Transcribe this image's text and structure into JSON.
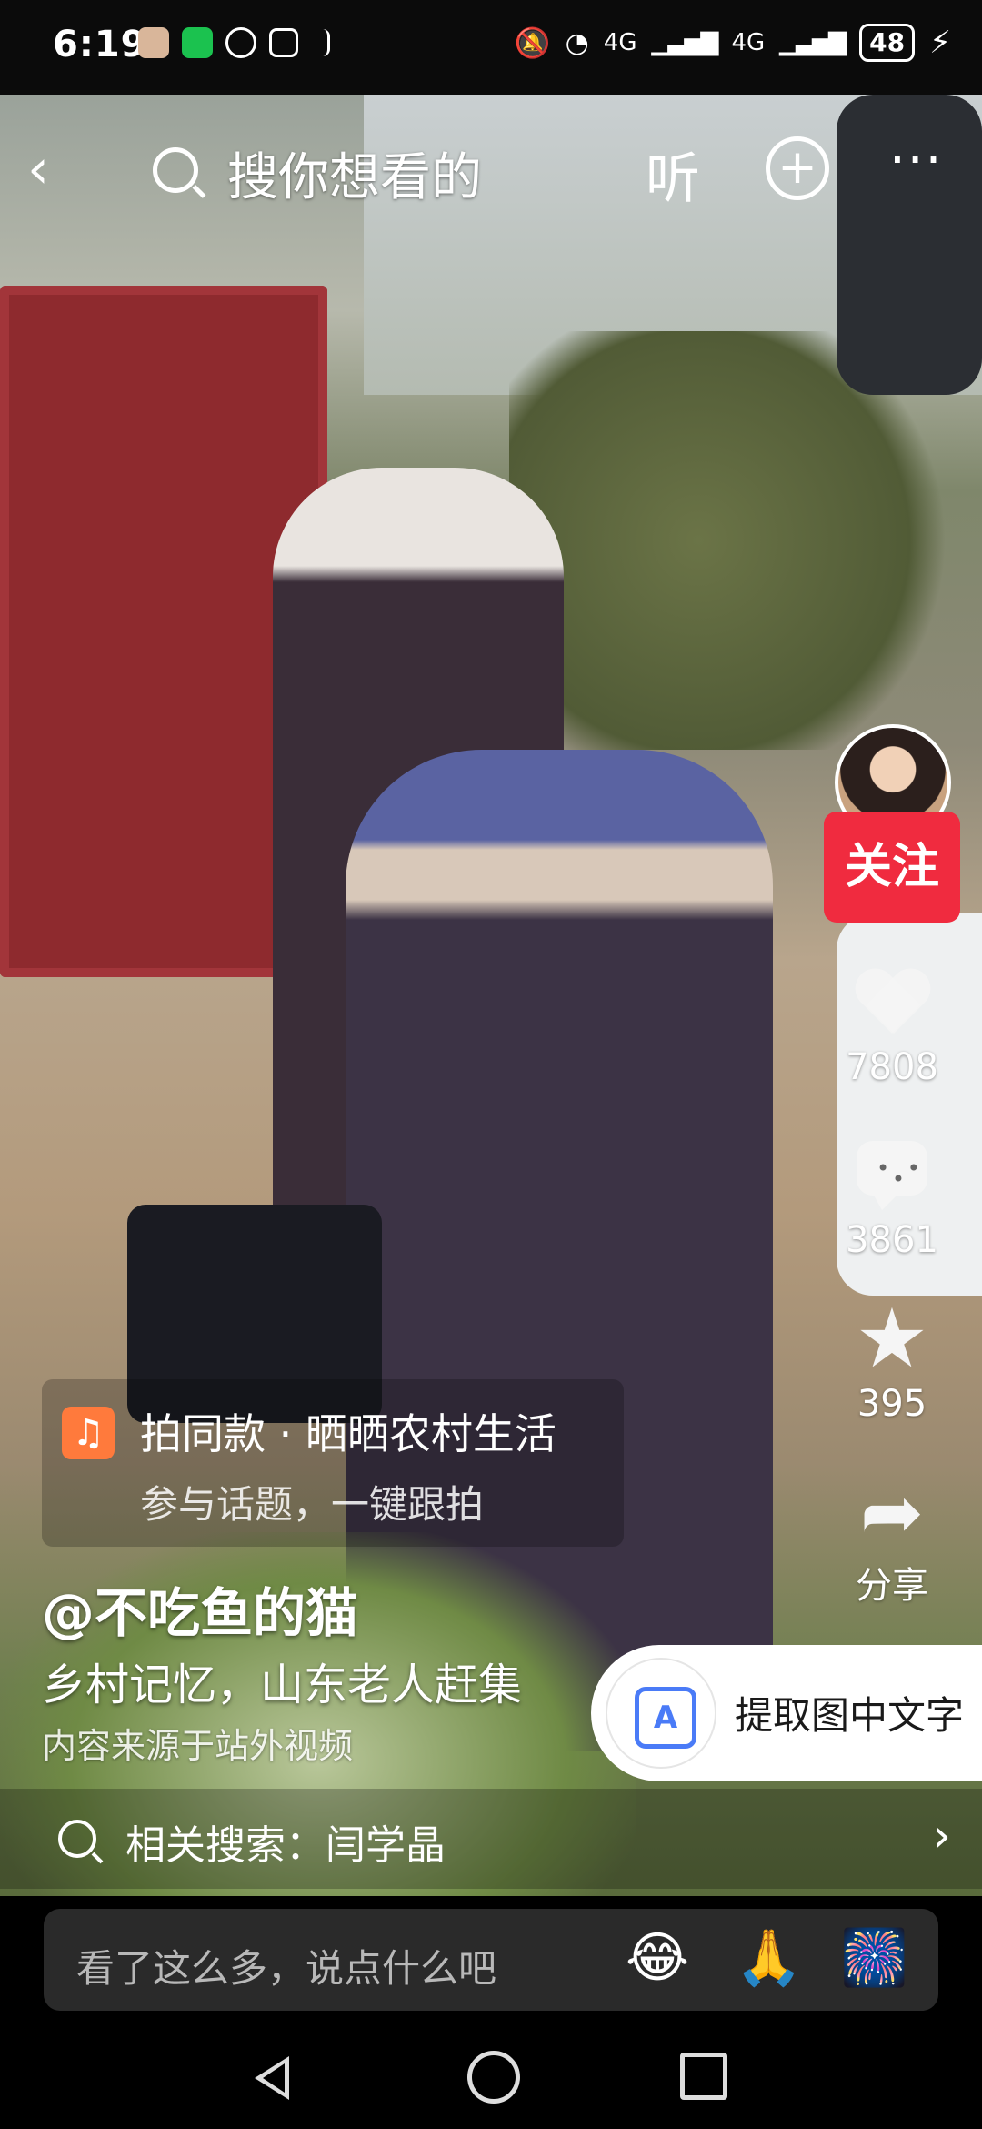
{
  "status_bar": {
    "time": "6:19",
    "battery": "48",
    "net1": "4G",
    "net2": "4G"
  },
  "top_bar": {
    "back_icon": "chevron-left",
    "search_placeholder": "搜你想看的",
    "listen_label": "听",
    "add_icon": "plus-circle",
    "more_label": "···"
  },
  "right_rail": {
    "follow_label": "关注",
    "likes": "7808",
    "comments": "3861",
    "favorites": "395",
    "share_label": "分享"
  },
  "same_style": {
    "title": "拍同款 · 晒晒农村生活",
    "subtitle": "参与话题，一键跟拍"
  },
  "post": {
    "author": "@不吃鱼的猫",
    "description": "乡村记忆，山东老人赶集",
    "source_note": "内容来源于站外视频"
  },
  "ocr_button": {
    "label": "提取图中文字",
    "icon_letter": "A"
  },
  "related_search": {
    "text": "相关搜索：闫学晶"
  },
  "comment_bar": {
    "placeholder": "看了这么多，说点什么吧",
    "emojis": [
      "😂",
      "🙏",
      "🎆"
    ]
  }
}
